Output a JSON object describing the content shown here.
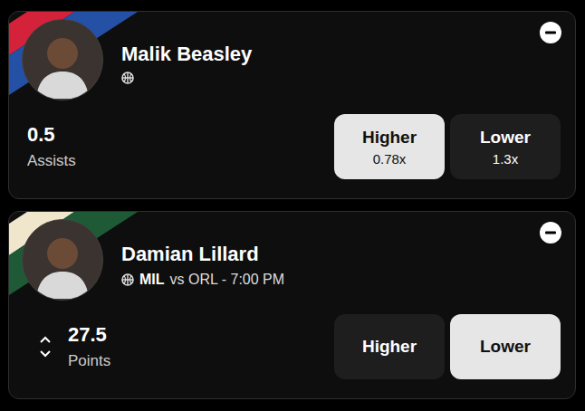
{
  "picks": [
    {
      "name": "Malik Beasley",
      "colors": [
        "#d3223a",
        "#2451a6"
      ],
      "stat_value": "0.5",
      "stat_label": "Assists",
      "adjustable": false,
      "options": [
        {
          "label": "Higher",
          "multiplier": "0.78x",
          "selected": true
        },
        {
          "label": "Lower",
          "multiplier": "1.3x",
          "selected": false
        }
      ]
    },
    {
      "name": "Damian Lillard",
      "colors": [
        "#efe6cc",
        "#1f5a36"
      ],
      "team": "MIL",
      "matchup": "vs ORL - 7:00 PM",
      "stat_value": "27.5",
      "stat_label": "Points",
      "adjustable": true,
      "options": [
        {
          "label": "Higher",
          "selected": false
        },
        {
          "label": "Lower",
          "selected": true
        }
      ]
    }
  ]
}
